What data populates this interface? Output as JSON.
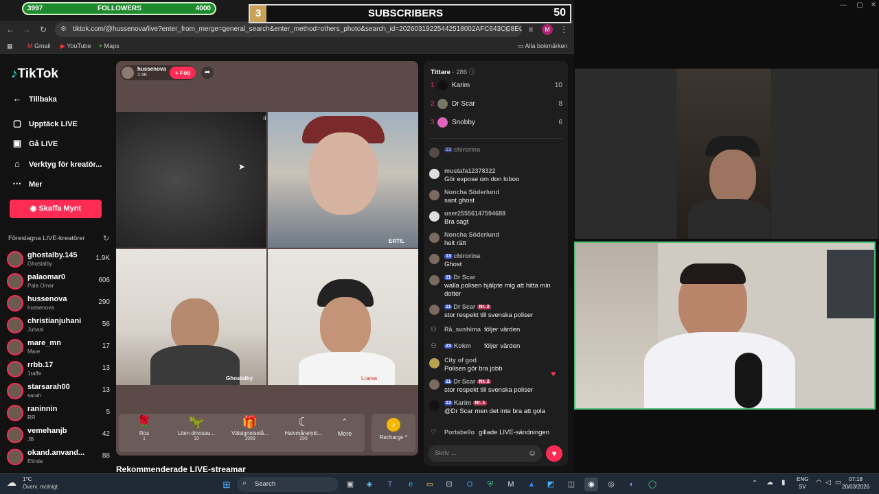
{
  "overlay": {
    "followers_current": "3997",
    "followers_label": "FOLLOWERS",
    "followers_goal": "4000",
    "subs_count_left": "3",
    "subs_label": "SUBSCRIBERS",
    "subs_count_right": "50"
  },
  "browser": {
    "url": "tiktok.com/@hussenova/live?enter_from_merge=general_search&enter_method=others_photo&search_id=20260319225442518002AFC643CC8EC0E...",
    "bookmarks": [
      "Gmail",
      "YouTube",
      "Maps"
    ],
    "all_bookmarks": "Alla bokmärken",
    "profile_initial": "M"
  },
  "sidebar": {
    "logo": "TikTok",
    "back": "Tillbaka",
    "nav": [
      "Upptäck LIVE",
      "Gå LIVE",
      "Verktyg för kreatör...",
      "Mer"
    ],
    "get_coins": "Skaffa Mynt",
    "suggested_title": "Föreslagna LIVE-kreatörer",
    "creators": [
      {
        "name": "ghostalby.145",
        "sub": "Ghostalby",
        "count": "1.9K"
      },
      {
        "name": "palaomar0",
        "sub": "Pala Omar",
        "count": "606"
      },
      {
        "name": "hussenova",
        "sub": "hussenova",
        "count": "290"
      },
      {
        "name": "christianjuhani",
        "sub": "Juhani",
        "count": "56"
      },
      {
        "name": "mare_mn",
        "sub": "Mare",
        "count": "17"
      },
      {
        "name": "rrbb.17",
        "sub": "1raffe",
        "count": "13"
      },
      {
        "name": "starsarah00",
        "sub": "sarah",
        "count": "13"
      },
      {
        "name": "raninnin",
        "sub": "RR",
        "count": "5"
      },
      {
        "name": "vemehanjb",
        "sub": "JB",
        "count": "42"
      },
      {
        "name": "okand.anvand...",
        "sub": "Elinda",
        "count": "88"
      }
    ]
  },
  "stream": {
    "host_name": "hussenova",
    "host_likes": "2.9K",
    "follow_label": "+ Följ",
    "tile_labels": {
      "top_right": "ERTIL",
      "bottom_left": "Ghostalby",
      "bottom_right": "Lrarea"
    },
    "gifts": [
      {
        "name": "Ros",
        "price": "1"
      },
      {
        "name": "Liten dinosau...",
        "price": "10"
      },
      {
        "name": "Välsignelselå...",
        "price": "1999"
      },
      {
        "name": "Halvmånelykt...",
        "price": "299"
      }
    ],
    "more_label": "More",
    "recharge_label": "Recharge ^",
    "recommended_heading": "Rekommenderade LIVE-streamar"
  },
  "chat": {
    "viewers_label": "Tittare",
    "viewers_count": "· 286",
    "ranking": [
      {
        "rank": "1",
        "name": "Karim",
        "score": "10"
      },
      {
        "rank": "2",
        "name": "Dr Scar",
        "score": "8"
      },
      {
        "rank": "3",
        "name": "Snobby",
        "score": "6"
      }
    ],
    "messages": [
      {
        "user": "chirorina",
        "level": "13",
        "text": "",
        "y": 0
      },
      {
        "user": "mustafa12378322",
        "level": "",
        "text": "Gör expose om don loboo"
      },
      {
        "user": "Noncha Söderlund",
        "level": "",
        "text": "sant ghost"
      },
      {
        "user": "user25556147594688",
        "level": "",
        "text": "Bra sagt"
      },
      {
        "user": "Noncha Söderlund",
        "level": "",
        "text": "helt rätt"
      },
      {
        "user": "chirorina",
        "level": "13",
        "text": "Ghost"
      },
      {
        "user": "Dr Scar",
        "level": "11",
        "text": "walla polisen hjälpte mig att hitta min dotter"
      },
      {
        "user": "Dr Scar",
        "level": "11",
        "nr": "Nr. 2",
        "text": "stor respekt till svenska poliser"
      },
      {
        "user": "Rå_sushima",
        "level": "",
        "text": "följer värden",
        "inline": true
      },
      {
        "user": "Kokm",
        "level": "23",
        "text": "följer värden",
        "inline": true
      },
      {
        "user": "City of god",
        "level": "",
        "text": "Polisen gör bra jobb"
      },
      {
        "user": "Dr Scar",
        "level": "11",
        "nr": "Nr. 2",
        "text": "stor respekt till svenska poliser"
      },
      {
        "user": "Karim",
        "level": "13",
        "nr": "Nr. 1",
        "text": "@Dr Scar  men det inte bra att gola"
      },
      {
        "user": "Portabello",
        "level": "",
        "text": "gillade LIVE-sändningen",
        "inline": true
      }
    ],
    "input_placeholder": "Skriv ..."
  },
  "taskbar": {
    "weather_temp": "1°C",
    "weather_desc": "Överv. molnigt",
    "search_label": "Search",
    "lang_top": "ENG",
    "lang_bottom": "SV",
    "time": "07:18",
    "date": "20/03/2026"
  }
}
